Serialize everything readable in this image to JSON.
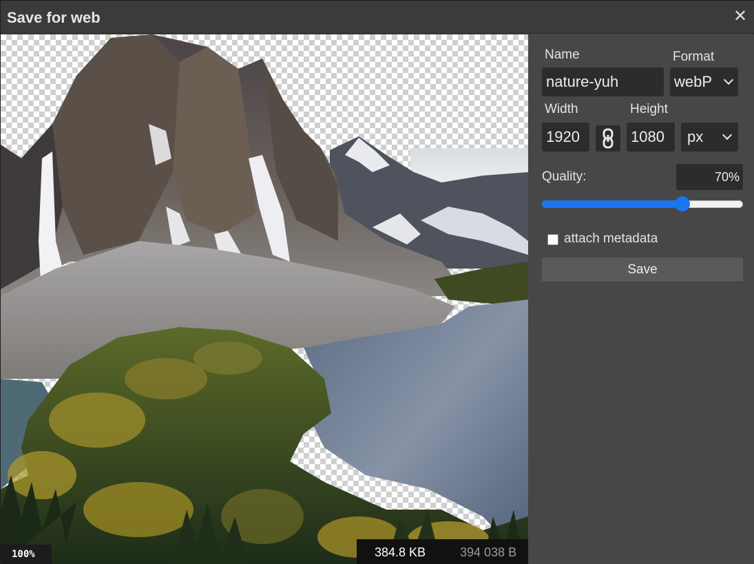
{
  "window": {
    "title": "Save for web"
  },
  "preview": {
    "zoom": "100%",
    "file_size": "384.8 KB",
    "file_bytes": "394 038 B"
  },
  "form": {
    "name_label": "Name",
    "name_value": "nature-yuh",
    "format_label": "Format",
    "format_value": "webP",
    "width_label": "Width",
    "width_value": "1920",
    "height_label": "Height",
    "height_value": "1080",
    "unit_value": "px",
    "quality_label": "Quality:",
    "quality_value": "70%",
    "quality_fraction": 0.7,
    "metadata_label": "attach metadata",
    "metadata_checked": false,
    "save_label": "Save"
  },
  "colors": {
    "accent": "#1976f0",
    "panel": "#474747",
    "field": "#2c2c2c"
  }
}
